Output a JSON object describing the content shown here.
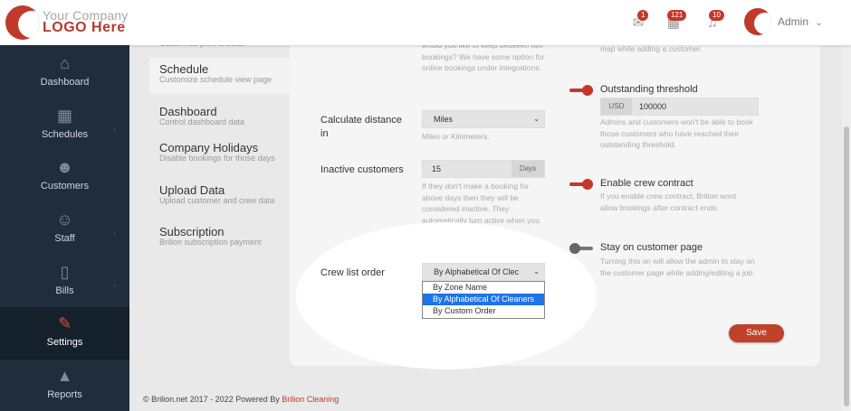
{
  "header": {
    "logo_line1": "Your Company",
    "logo_line2": "LOGO Here",
    "notifications": [
      {
        "icon": "envelope-icon",
        "glyph": "✉",
        "count": "1"
      },
      {
        "icon": "calendar-icon",
        "glyph": "▦",
        "count": "121"
      },
      {
        "icon": "bell-icon",
        "glyph": "♫",
        "count": "10"
      }
    ],
    "user_name": "Admin",
    "user_chevron": "⌄"
  },
  "sidebar": {
    "items": [
      {
        "label": "Dashboard",
        "icon": "home-icon",
        "glyph": "⌂"
      },
      {
        "label": "Schedules",
        "icon": "calendar-icon",
        "glyph": "▦",
        "arrow": "‹"
      },
      {
        "label": "Customers",
        "icon": "users-icon",
        "glyph": "☻"
      },
      {
        "label": "Staff",
        "icon": "staff-icon",
        "glyph": "☺",
        "arrow": "‹"
      },
      {
        "label": "Bills",
        "icon": "file-icon",
        "glyph": "▯",
        "arrow": "‹"
      },
      {
        "label": "Settings",
        "icon": "wrench-icon",
        "glyph": "✎"
      },
      {
        "label": "Reports",
        "icon": "chart-icon",
        "glyph": "▲"
      }
    ]
  },
  "settings_menu": {
    "top_partial": "Customise print sheets.",
    "items": [
      {
        "title": "Schedule",
        "sub": "Customize schedule view page"
      },
      {
        "title": "Dashboard",
        "sub": "Control dashboard data"
      },
      {
        "title": "Company Holidays",
        "sub": "Disable bookings for those days"
      },
      {
        "title": "Upload Data",
        "sub": "Upload customer and crew data"
      },
      {
        "title": "Subscription",
        "sub": "Brilion subscription payment"
      }
    ]
  },
  "form": {
    "top_help": "would you like to keep between two bookings? We have some option for online bookings under integrations.",
    "distance": {
      "label": "Calculate distance in",
      "value": "Miles",
      "help": "Miles or Kilometers."
    },
    "inactive": {
      "label": "Inactive customers",
      "value": "15",
      "addon": "Days",
      "help": "If they don't make a booking for above days then they will be considered inactive. They automatically turn active when you make a booking for them."
    },
    "crew_order": {
      "label": "Crew list order",
      "value": "By Alphabetical Of Clec",
      "options": [
        "By Zone Name",
        "By Alphabetical Of Cleaners",
        "By Custom Order"
      ],
      "selected_option": "By Alphabetical Of Cleaners"
    },
    "right_top_help": "map while adding a customer.",
    "threshold": {
      "label": "Outstanding threshold",
      "currency": "USD",
      "value": "100000",
      "help": "Admins and customers won't be able to book those customers who have reached their outstanding threshold.",
      "enabled": true
    },
    "crew_contract": {
      "label": "Enable crew contract",
      "help": "If you enable crew contract, Brilion wont allow bookings after contract ends.",
      "enabled": true
    },
    "stay_page": {
      "label": "Stay on customer page",
      "help": "Turning this on will allow the admin to stay on the customer page while adding/editing a job.",
      "enabled": false
    },
    "save_label": "Save"
  },
  "footer": {
    "text": "© Brilion.net 2017 - 2022 Powered By",
    "brand": "Brilion Cleaning"
  },
  "colors": {
    "accent": "#c0392b",
    "sidebar": "#1f2d3d",
    "highlight": "#1e73e8"
  }
}
